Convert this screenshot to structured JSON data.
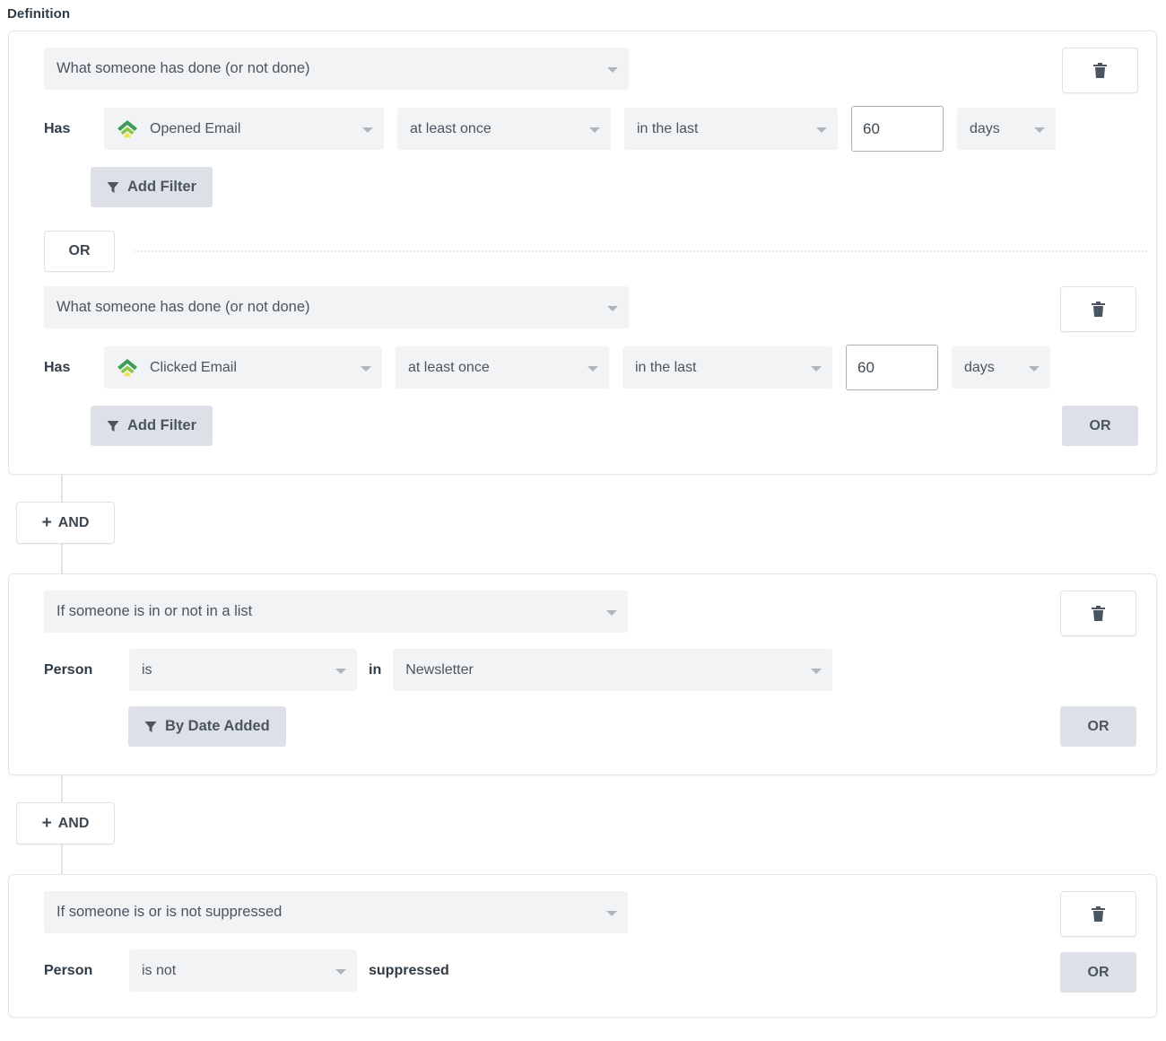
{
  "section": {
    "title": "Definition"
  },
  "icons": {
    "trash": "trash-icon",
    "funnel": "funnel-icon",
    "caret": "chevron-down-icon",
    "metric": "klaviyo-signal-icon",
    "plus": "+"
  },
  "labels": {
    "and": "AND",
    "or": "OR",
    "has": "Has",
    "person": "Person",
    "in": "in",
    "suppressed": "suppressed"
  },
  "colors": {
    "field_bg": "#f1f3f5",
    "button_bg": "#dde1e7",
    "text": "#3d4852",
    "border": "#e2e6ea",
    "icon_green_dark": "#3f9c5a",
    "icon_green_light": "#a4d65e",
    "icon_yellow": "#f0e442"
  },
  "blocks": [
    {
      "name": "behavior-block",
      "groups": [
        {
          "type": "What someone has done (or not done)",
          "lead": "Has",
          "metric": "Opened Email",
          "frequency": "at least once",
          "timeframe": "in the last",
          "amount": "60",
          "unit": "days",
          "filter_button": "Add Filter",
          "or_side": null
        },
        {
          "type": "What someone has done (or not done)",
          "lead": "Has",
          "metric": "Clicked Email",
          "frequency": "at least once",
          "timeframe": "in the last",
          "amount": "60",
          "unit": "days",
          "filter_button": "Add Filter",
          "or_side": "OR"
        }
      ]
    },
    {
      "name": "list-block",
      "groups": [
        {
          "type": "If someone is in or not in a list",
          "lead": "Person",
          "operator": "is",
          "preposition": "in",
          "list": "Newsletter",
          "filter_button": "By Date Added",
          "or_side": "OR"
        }
      ]
    },
    {
      "name": "suppression-block",
      "groups": [
        {
          "type": "If someone is or is not suppressed",
          "lead": "Person",
          "operator": "is not",
          "trailing_word": "suppressed",
          "or_side": "OR"
        }
      ]
    }
  ]
}
